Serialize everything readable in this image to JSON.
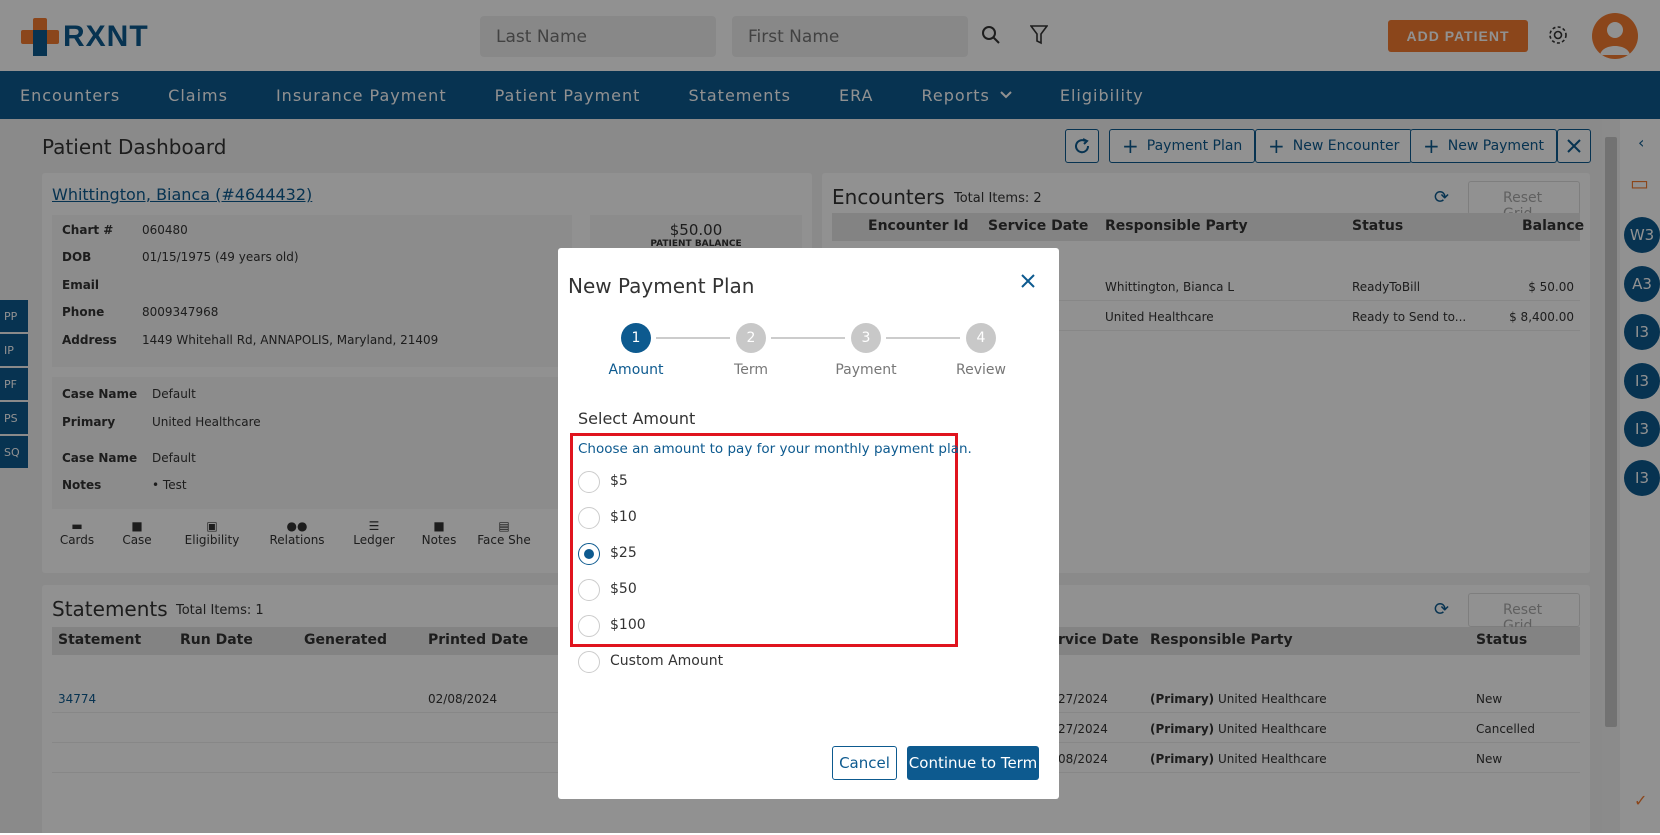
{
  "header": {
    "logo_text": "RXNT",
    "last_name_placeholder": "Last Name",
    "first_name_placeholder": "First Name",
    "add_patient_label": "ADD PATIENT"
  },
  "nav": {
    "items": [
      "Encounters",
      "Claims",
      "Insurance Payment",
      "Patient Payment",
      "Statements",
      "ERA",
      "Reports",
      "Eligibility"
    ]
  },
  "dashboard": {
    "title": "Patient Dashboard",
    "buttons": {
      "payment_plan": "Payment Plan",
      "new_encounter": "New Encounter",
      "new_payment": "New Payment"
    }
  },
  "patient": {
    "name_link": "Whittington, Bianca (#4644432)",
    "fields": [
      {
        "label": "Chart #",
        "value": "060480"
      },
      {
        "label": "DOB",
        "value": "01/15/1975 (49 years old)"
      },
      {
        "label": "Email",
        "value": ""
      },
      {
        "label": "Phone",
        "value": "8009347968"
      },
      {
        "label": "Address",
        "value": "1449 Whitehall Rd, ANNAPOLIS, Maryland, 21409"
      }
    ],
    "balance": "$50.00",
    "balance_label": "PATIENT BALANCE",
    "case": [
      {
        "label": "Case Name",
        "value": "Default"
      },
      {
        "label": "Primary",
        "value": "United Healthcare"
      },
      {
        "label": "Case Name",
        "value": "Default"
      },
      {
        "label": "Notes",
        "value": "Test"
      }
    ],
    "actions": [
      "Cards",
      "Case",
      "Eligibility",
      "Relations",
      "Ledger",
      "Notes",
      "Face She"
    ]
  },
  "side_tabs": [
    "PP",
    "IP",
    "PF",
    "PS",
    "SQ"
  ],
  "encounters": {
    "title": "Encounters",
    "total": "Total Items: 2",
    "reset": "Reset Grid",
    "columns": [
      "Encounter Id",
      "Service Date",
      "Responsible Party",
      "Status",
      "Balance"
    ],
    "rows": [
      {
        "party": "Whittington, Bianca L",
        "status": "ReadyToBill",
        "balance": "$ 50.00"
      },
      {
        "party": "United Healthcare",
        "status": "Ready to Send to...",
        "balance": "$ 8,400.00"
      }
    ]
  },
  "statements": {
    "title": "Statements",
    "total": "Total Items: 1",
    "reset": "Reset Grid",
    "columns": [
      "Statement",
      "Run Date",
      "Generated",
      "Printed Date"
    ],
    "right_columns": [
      "rvice Date",
      "Responsible Party",
      "Status"
    ],
    "rows": [
      {
        "statement": "34774",
        "printed": "02/08/2024"
      }
    ],
    "right_rows": [
      {
        "date": "27/2024",
        "primary": "(Primary)",
        "party": "United Healthcare",
        "status": "New"
      },
      {
        "date": "27/2024",
        "primary": "(Primary)",
        "party": "United Healthcare",
        "status": "Cancelled"
      },
      {
        "date": "08/2024",
        "primary": "(Primary)",
        "party": "United Healthcare",
        "status": "New"
      }
    ]
  },
  "right_bar": {
    "circles": [
      "W3",
      "A3",
      "I3",
      "I3",
      "I3",
      "I3"
    ]
  },
  "modal": {
    "title": "New Payment Plan",
    "steps": [
      {
        "num": "1",
        "label": "Amount"
      },
      {
        "num": "2",
        "label": "Term"
      },
      {
        "num": "3",
        "label": "Payment"
      },
      {
        "num": "4",
        "label": "Review"
      }
    ],
    "section_title": "Select Amount",
    "instruction": "Choose an amount to pay for your monthly payment plan.",
    "options": [
      "$5",
      "$10",
      "$25",
      "$50",
      "$100",
      "Custom Amount"
    ],
    "selected": "$25",
    "cancel_label": "Cancel",
    "continue_label": "Continue to Term"
  },
  "colors": {
    "brand_blue": "#0d5a8f",
    "accent_orange": "#f47b30",
    "highlight_red": "#e0141e"
  }
}
